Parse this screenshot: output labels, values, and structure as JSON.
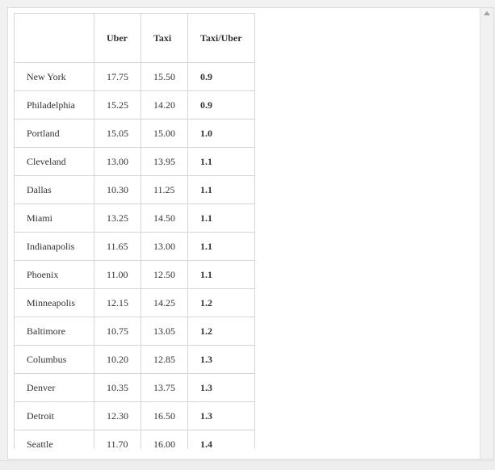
{
  "table": {
    "headers": [
      "",
      "Uber",
      "Taxi",
      "Taxi/Uber"
    ],
    "rows": [
      {
        "city": "New York",
        "uber": "17.75",
        "taxi": "15.50",
        "ratio": "0.9"
      },
      {
        "city": "Philadelphia",
        "uber": "15.25",
        "taxi": "14.20",
        "ratio": "0.9"
      },
      {
        "city": "Portland",
        "uber": "15.05",
        "taxi": "15.00",
        "ratio": "1.0"
      },
      {
        "city": "Cleveland",
        "uber": "13.00",
        "taxi": "13.95",
        "ratio": "1.1"
      },
      {
        "city": "Dallas",
        "uber": "10.30",
        "taxi": "11.25",
        "ratio": "1.1"
      },
      {
        "city": "Miami",
        "uber": "13.25",
        "taxi": "14.50",
        "ratio": "1.1"
      },
      {
        "city": "Indianapolis",
        "uber": "11.65",
        "taxi": "13.00",
        "ratio": "1.1"
      },
      {
        "city": "Phoenix",
        "uber": "11.00",
        "taxi": "12.50",
        "ratio": "1.1"
      },
      {
        "city": "Minneapolis",
        "uber": "12.15",
        "taxi": "14.25",
        "ratio": "1.2"
      },
      {
        "city": "Baltimore",
        "uber": "10.75",
        "taxi": "13.05",
        "ratio": "1.2"
      },
      {
        "city": "Columbus",
        "uber": "10.20",
        "taxi": "12.85",
        "ratio": "1.3"
      },
      {
        "city": "Denver",
        "uber": "10.35",
        "taxi": "13.75",
        "ratio": "1.3"
      },
      {
        "city": "Detroit",
        "uber": "12.30",
        "taxi": "16.50",
        "ratio": "1.3"
      },
      {
        "city": "Seattle",
        "uber": "11.70",
        "taxi": "16.00",
        "ratio": "1.4"
      }
    ]
  },
  "icons": {
    "scroll_up": "scroll-up-arrow-icon"
  }
}
